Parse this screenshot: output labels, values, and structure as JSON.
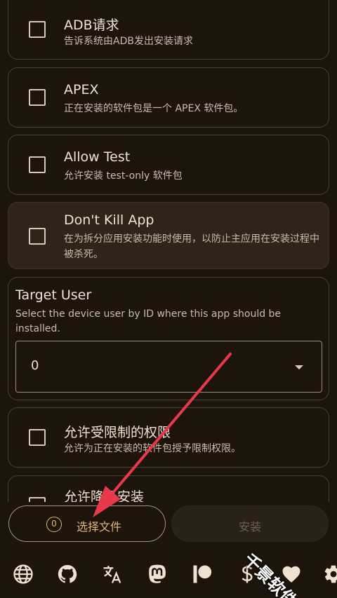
{
  "options": [
    {
      "title": "ADB请求",
      "desc": "告诉系统由ADB发出安装请求"
    },
    {
      "title": "APEX",
      "desc": "正在安装的软件包是一个 APEX 软件包。"
    },
    {
      "title": "Allow Test",
      "desc": "允许安装 test-only 软件包"
    },
    {
      "title": "Don't Kill App",
      "desc": "在为拆分应用安装功能时使用，以防止主应用在安装过程中被杀死。"
    },
    {
      "title": "允许受限制的权限",
      "desc": "允许为正在安装的软件包授予限制权限。"
    },
    {
      "title": "允许降级安装",
      "desc": ""
    }
  ],
  "target_user": {
    "title": "Target User",
    "desc": "Select the device user by ID where this app should be installed.",
    "selected_value": "0"
  },
  "bottom": {
    "select_file_count": "0",
    "select_file_label": "选择文件",
    "install_label": "安装"
  },
  "nav_icons": [
    "globe-icon",
    "github-icon",
    "translate-icon",
    "mastodon-icon",
    "patreon-icon",
    "dollar-icon",
    "heart-icon",
    "gear-icon"
  ],
  "watermark": "千景软件站",
  "colors": {
    "background": "#1d140c",
    "accent": "#e6b57a",
    "annotation_arrow": "#e8394a"
  }
}
